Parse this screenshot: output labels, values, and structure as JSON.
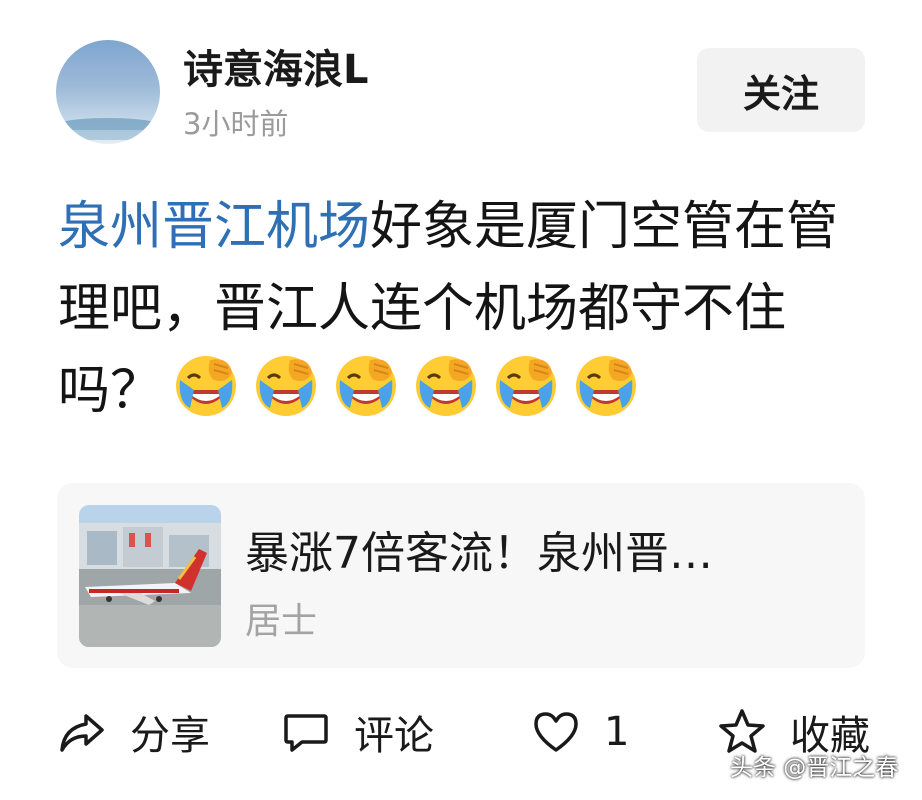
{
  "user": {
    "name": "诗意海浪L",
    "time_ago": "3小时前",
    "follow_label": "关注"
  },
  "post": {
    "topic_link": "泉州晋江机场",
    "text": "好象是厦门空管在管理吧，晋江人连个机场都守不住吗？",
    "emojis": [
      "laugh-crying-emoji",
      "laugh-crying-emoji",
      "laugh-crying-emoji",
      "laugh-crying-emoji",
      "laugh-crying-emoji",
      "laugh-crying-emoji"
    ]
  },
  "article_card": {
    "title": "暴涨7倍客流！泉州晋…",
    "source": "居士",
    "thumbnail": "airport-airplane-image"
  },
  "actions": {
    "share_label": "分享",
    "comment_label": "评论",
    "like_count": "1",
    "favorite_label": "收藏"
  },
  "watermark": "头条 @晋江之春",
  "colors": {
    "link": "#2f6fb5",
    "muted": "#9b9b9b",
    "card_bg": "#f7f7f8",
    "button_bg": "#f2f2f2"
  }
}
